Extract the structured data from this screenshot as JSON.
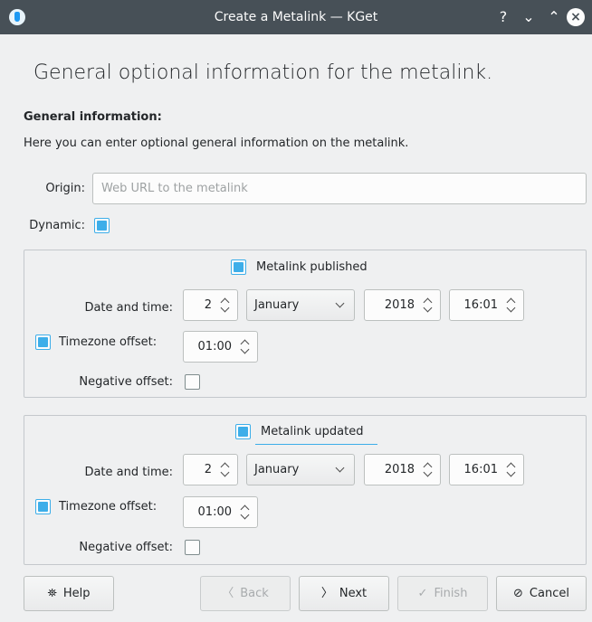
{
  "window": {
    "title": "Create a Metalink — KGet",
    "help_glyph": "?",
    "minimize_glyph": "⌄",
    "maximize_glyph": "⌃",
    "close_glyph": "×"
  },
  "page": {
    "heading": "General optional information for the metalink.",
    "section_title": "General information:",
    "section_description": "Here you can enter optional general information on the metalink."
  },
  "origin": {
    "label": "Origin:",
    "placeholder": "Web URL to the metalink",
    "value": ""
  },
  "dynamic": {
    "label": "Dynamic:",
    "checked": true
  },
  "published": {
    "title": "Metalink published",
    "checked": true,
    "date_label": "Date and time:",
    "day": "2",
    "month": "January",
    "year": "2018",
    "time": "16:01",
    "timezone_label": "Timezone offset:",
    "timezone_checked": true,
    "timezone_value": "01:00",
    "negative_label": "Negative offset:",
    "negative_checked": false
  },
  "updated": {
    "title": "Metalink updated",
    "checked": true,
    "date_label": "Date and time:",
    "day": "2",
    "month": "January",
    "year": "2018",
    "time": "16:01",
    "timezone_label": "Timezone offset:",
    "timezone_checked": true,
    "timezone_value": "01:00",
    "negative_label": "Negative offset:",
    "negative_checked": false
  },
  "buttons": {
    "help": {
      "label": "Help",
      "icon": "help-icon"
    },
    "back": {
      "label": "Back",
      "icon": "chevron-left-icon",
      "enabled": false
    },
    "next": {
      "label": "Next",
      "icon": "chevron-right-icon",
      "enabled": true
    },
    "finish": {
      "label": "Finish",
      "icon": "check-icon",
      "enabled": false
    },
    "cancel": {
      "label": "Cancel",
      "icon": "cancel-icon"
    }
  },
  "glyphs": {
    "help": "⛯",
    "back": "〈",
    "next": "〉",
    "finish": "✓",
    "cancel": "⊘"
  },
  "colors": {
    "accent": "#3daee9",
    "titlebar": "#475057",
    "window_bg": "#eff0f1"
  }
}
